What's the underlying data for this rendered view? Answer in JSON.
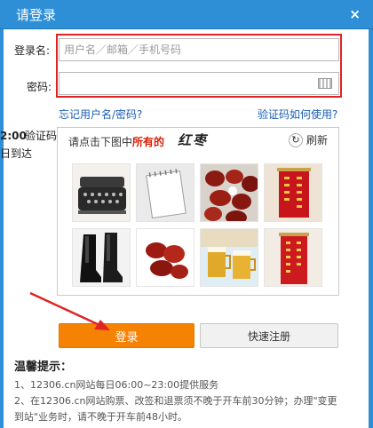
{
  "dialog": {
    "title": "请登录",
    "close_glyph": "×"
  },
  "form": {
    "username_label": "登录名:",
    "username_placeholder": "用户名／邮箱／手机号码",
    "password_label": "密码:",
    "password_value": "",
    "captcha_label": "验证码:"
  },
  "links": {
    "forgot": "忘记用户名/密码?",
    "captcha_help": "验证码如何使用?"
  },
  "side_notice": {
    "time": "2:00",
    "daily": "日到达"
  },
  "captcha": {
    "instruction_prefix": "请点击下图中",
    "instruction_highlight": "所有的",
    "target_word": "红枣",
    "refresh_label": "刷新",
    "refresh_glyph": "↻",
    "tiles": [
      {
        "icon": "typewriter-icon"
      },
      {
        "icon": "notepad-icon"
      },
      {
        "icon": "red-dates-icon"
      },
      {
        "icon": "red-banner-icon"
      },
      {
        "icon": "boots-icon"
      },
      {
        "icon": "red-dates-icon"
      },
      {
        "icon": "beer-mugs-icon"
      },
      {
        "icon": "red-banner-icon"
      }
    ]
  },
  "buttons": {
    "login": "登录",
    "register": "快速注册"
  },
  "tips": {
    "title": "温馨提示：",
    "line1": "1、12306.cn网站每日06:00~23:00提供服务",
    "line2": "2、在12306.cn网站购票、改签和退票须不晚于开车前30分钟；办理\"变更",
    "line3": "到站\"业务时，请不晚于开车前48小时。"
  },
  "colors": {
    "title_bar": "#2f8fd6",
    "login_button": "#f68204",
    "highlight_box": "#e02424",
    "link": "#1a5fb4"
  }
}
